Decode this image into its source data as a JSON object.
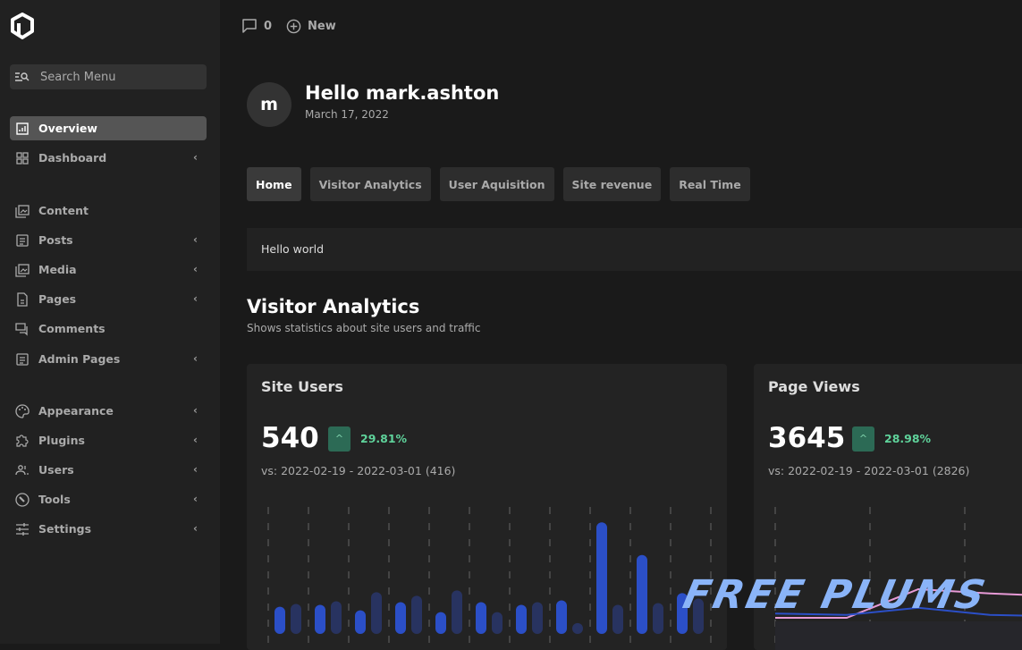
{
  "sidebar": {
    "search_placeholder": "Search Menu",
    "items": [
      {
        "label": "Overview",
        "icon": "chart-icon",
        "active": true,
        "chevron": false
      },
      {
        "label": "Dashboard",
        "icon": "grid-icon",
        "chevron": true
      },
      {
        "label": "Content",
        "icon": "image-stack-icon",
        "chevron": false
      },
      {
        "label": "Posts",
        "icon": "document-icon",
        "chevron": true
      },
      {
        "label": "Media",
        "icon": "image-stack-icon",
        "chevron": true
      },
      {
        "label": "Pages",
        "icon": "file-icon",
        "chevron": true
      },
      {
        "label": "Comments",
        "icon": "comments-icon",
        "chevron": false
      },
      {
        "label": "Admin Pages",
        "icon": "document-icon",
        "chevron": true
      },
      {
        "label": "Appearance",
        "icon": "palette-icon",
        "chevron": true
      },
      {
        "label": "Plugins",
        "icon": "puzzle-icon",
        "chevron": true
      },
      {
        "label": "Users",
        "icon": "users-icon",
        "chevron": true
      },
      {
        "label": "Tools",
        "icon": "wrench-icon",
        "chevron": true
      },
      {
        "label": "Settings",
        "icon": "sliders-icon",
        "chevron": true
      }
    ]
  },
  "topbar": {
    "comments_count": "0",
    "new_label": "New"
  },
  "user": {
    "initial": "m",
    "greeting": "Hello mark.ashton",
    "date": "March 17, 2022"
  },
  "tabs": [
    {
      "label": "Home",
      "active": true
    },
    {
      "label": "Visitor Analytics"
    },
    {
      "label": "User Aquisition"
    },
    {
      "label": "Site revenue"
    },
    {
      "label": "Real Time"
    }
  ],
  "notice": "Hello world",
  "section": {
    "title": "Visitor Analytics",
    "subtitle": "Shows statistics about site users and traffic"
  },
  "cards": [
    {
      "title": "Site Users",
      "value": "540",
      "change": "29.81%",
      "compare": "vs: 2022-02-19 - 2022-03-01 (416)"
    },
    {
      "title": "Page Views",
      "value": "3645",
      "change": "28.98%",
      "compare": "vs: 2022-02-19 - 2022-03-01 (2826)"
    }
  ],
  "colors": {
    "current": "#2b4fc7",
    "previous": "#283360",
    "positive": "#5fd39b",
    "line_pink": "#e79ad6",
    "line_blue": "#2b4fc7"
  },
  "chart_data": [
    {
      "type": "bar",
      "series": [
        {
          "values": [
            30,
            32,
            26,
            35,
            24,
            35,
            32,
            37,
            123,
            87,
            45
          ]
        },
        {
          "values": [
            33,
            36,
            46,
            42,
            48,
            24,
            35,
            12,
            32,
            34,
            39
          ]
        }
      ],
      "ylim": [
        0,
        140
      ],
      "grid": "vertical dashed"
    },
    {
      "type": "line",
      "series": [
        {
          "values": [
            8,
            7,
            12,
            7,
            6
          ]
        },
        {
          "values": [
            5,
            5,
            25,
            22,
            20
          ]
        }
      ],
      "grid": "vertical dashed"
    }
  ],
  "watermark": "Free Plums"
}
